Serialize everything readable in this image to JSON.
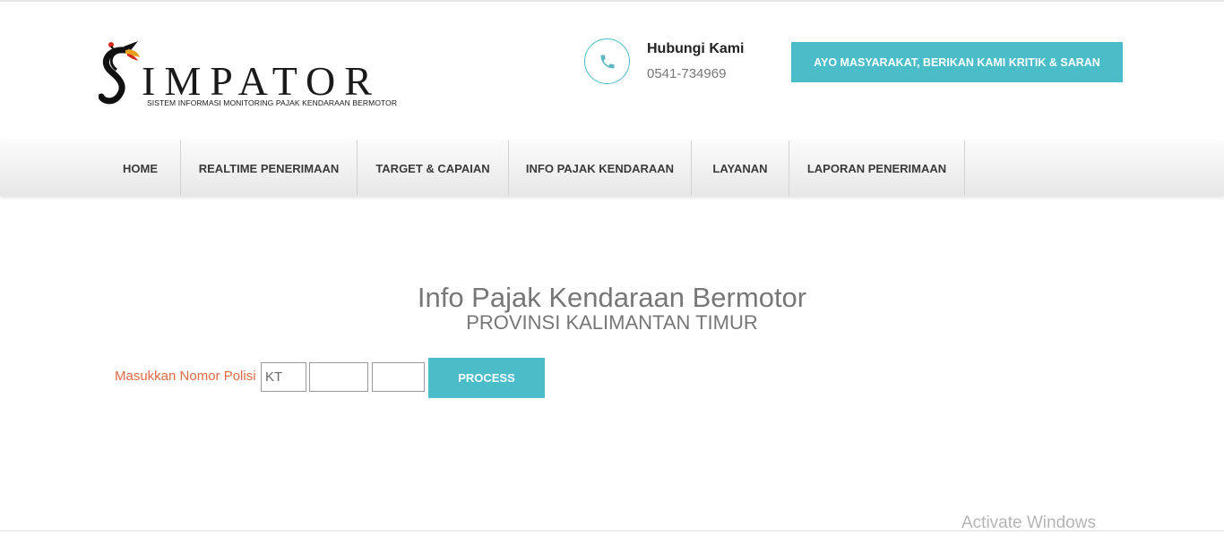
{
  "logo": {
    "word": "IMPATOR",
    "tagline": "SISTEM INFORMASI MONITORING PAJAK KENDARAAN BERMOTOR"
  },
  "contact": {
    "icon": "phone-icon",
    "title": "Hubungi Kami",
    "phone": "0541-734969"
  },
  "cta_label": "AYO MASYARAKAT, BERIKAN KAMI KRITIK & SARAN",
  "nav": {
    "home": "HOME",
    "realtime": "REALTIME PENERIMAAN",
    "target": "TARGET & CAPAIAN",
    "info": "INFO PAJAK KENDARAAN",
    "layanan": "LAYANAN",
    "laporan": "LAPORAN PENERIMAAN"
  },
  "main": {
    "title": "Info Pajak Kendaraan Bermotor",
    "subtitle": "PROVINSI KALIMANTAN TIMUR",
    "form_label": "Masukkan Nomor Polisi",
    "plate_prefix": "KT",
    "plate_number": "",
    "plate_suffix": "",
    "process_label": "PROCESS"
  },
  "watermark": "Activate Windows",
  "colors": {
    "accent": "#4bbdc8",
    "label": "#e06a45"
  }
}
